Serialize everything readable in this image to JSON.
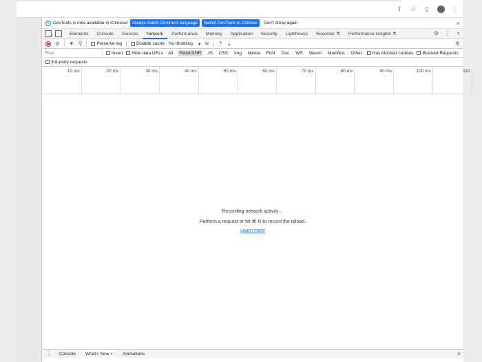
{
  "browser": {
    "icons": [
      "share-icon",
      "star-icon",
      "sidebar-icon",
      "profile-avatar",
      "kebab-menu-icon"
    ]
  },
  "banner": {
    "message": "DevTools is now available in Chinese!",
    "button_match": "Always match Chrome's language",
    "button_switch": "Switch DevTools to Chinese",
    "button_dismiss": "Don't show again",
    "close": "×"
  },
  "tabs": [
    {
      "label": "Elements"
    },
    {
      "label": "Console"
    },
    {
      "label": "Sources"
    },
    {
      "label": "Network"
    },
    {
      "label": "Performance"
    },
    {
      "label": "Memory"
    },
    {
      "label": "Application"
    },
    {
      "label": "Security"
    },
    {
      "label": "Lighthouse"
    },
    {
      "label": "Recorder ⚗"
    },
    {
      "label": "Performance insights ⚗"
    }
  ],
  "toolbar": {
    "preserve_log": "Preserve log",
    "disable_cache": "Disable cache",
    "throttling": "No throttling",
    "throttling_arrow": "▾"
  },
  "filterbar": {
    "placeholder": "Filter",
    "invert": "Invert",
    "hide_data_urls": "Hide data URLs",
    "types": [
      "All",
      "Fetch/XHR",
      "JS",
      "CSS",
      "Img",
      "Media",
      "Font",
      "Doc",
      "WS",
      "Wasm",
      "Manifest",
      "Other"
    ],
    "selected_type": "Fetch/XHR",
    "blocked_cookies": "Has blocked cookies",
    "blocked_requests": "Blocked Requests",
    "third_party": "3rd-party requests"
  },
  "timeline": {
    "ticks": [
      "10 ms",
      "20 ms",
      "30 ms",
      "40 ms",
      "50 ms",
      "60 ms",
      "70 ms",
      "80 ms",
      "90 ms",
      "100 ms",
      "110"
    ]
  },
  "empty_state": {
    "line1": "Recording network activity…",
    "line2": "Perform a request or hit ⌘ R to record the reload.",
    "link": "Learn more"
  },
  "drawer": {
    "tabs": [
      "Console",
      "What's New",
      "Animations"
    ],
    "active_close": "×",
    "close": "×"
  },
  "colors": {
    "accent": "#1a73e8",
    "record": "#d93025"
  }
}
